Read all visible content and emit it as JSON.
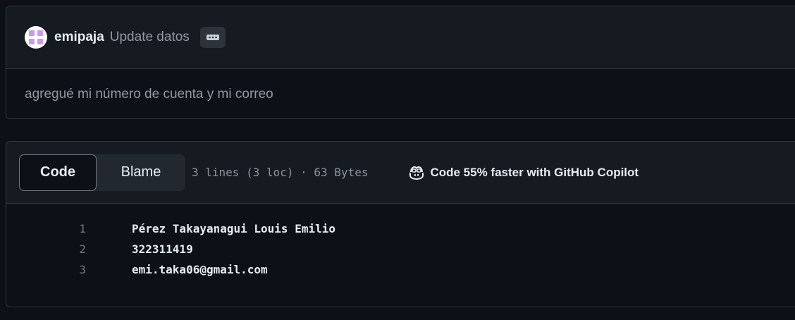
{
  "commit": {
    "author": "emipaja",
    "title": "Update datos",
    "message": "agregué mi número de cuenta y mi correo",
    "avatar_color": "#c99be6",
    "more_icon": "kebab-horizontal-icon"
  },
  "file": {
    "tabs": {
      "code_label": "Code",
      "blame_label": "Blame"
    },
    "info": "3 lines (3 loc) · 63 Bytes",
    "copilot": {
      "icon": "copilot-icon",
      "label": "Code 55% faster with GitHub Copilot"
    },
    "lines": [
      {
        "number": "1",
        "text": "Pérez Takayanagui Louis Emilio"
      },
      {
        "number": "2",
        "text": "322311419"
      },
      {
        "number": "3",
        "text": "emi.taka06@gmail.com"
      }
    ]
  },
  "colors": {
    "background": "#0d1117",
    "panel": "#161b22",
    "border": "#30363d",
    "muted_text": "#9198a1",
    "text": "#e6edf3"
  }
}
